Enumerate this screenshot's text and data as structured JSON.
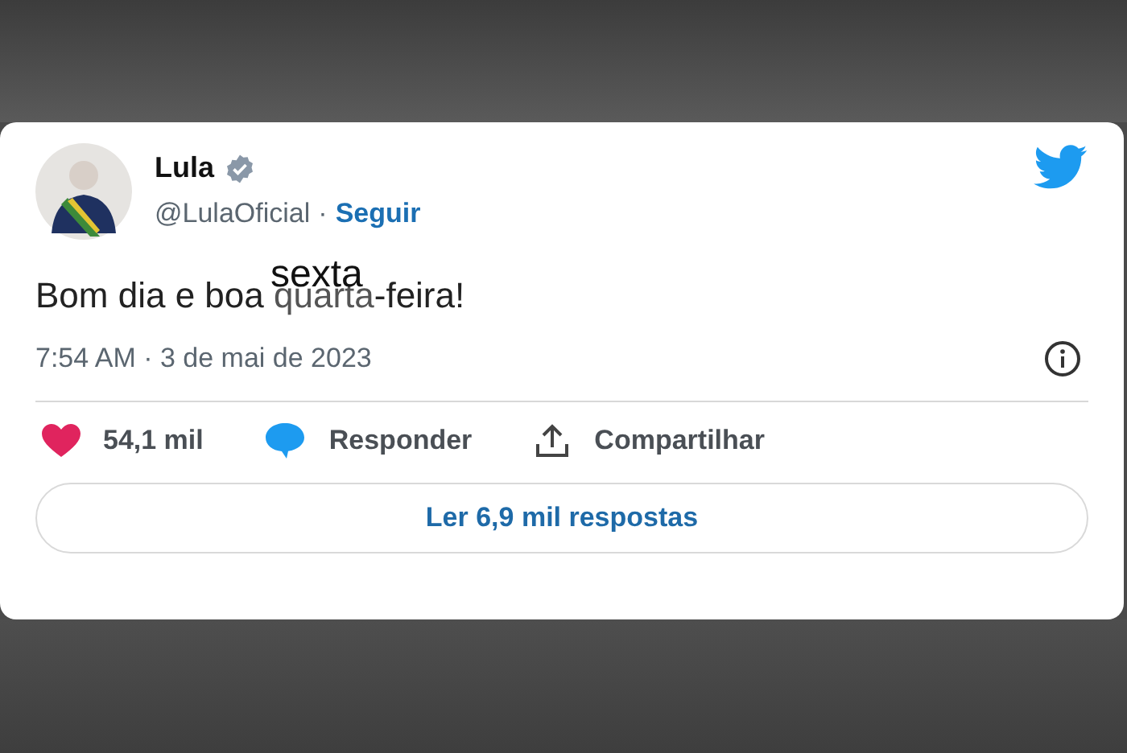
{
  "tweet": {
    "author": {
      "name": "Lula",
      "verified": true,
      "handle": "@LulaOficial",
      "separator": "·",
      "follow": "Seguir"
    },
    "text": {
      "before": "Bom dia e boa ",
      "covered": "quarta",
      "overlay": "sexta",
      "after": "-feira!"
    },
    "timestamp": "7:54 AM · 3 de mai de 2023",
    "actions": [
      {
        "kind": "like",
        "label": "54,1 mil"
      },
      {
        "kind": "reply",
        "label": "Responder"
      },
      {
        "kind": "share",
        "label": "Compartilhar"
      }
    ],
    "replies_button": "Ler 6,9 mil respostas"
  }
}
